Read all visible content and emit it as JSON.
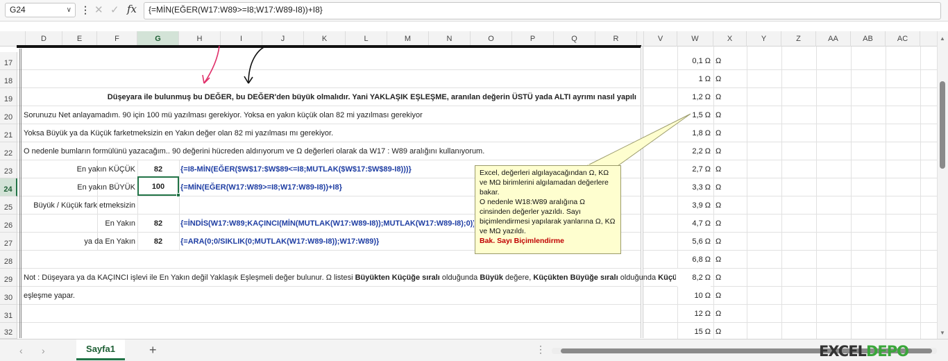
{
  "formula_bar": {
    "name_box": "G24",
    "formula": "{=MİN(EĞER(W17:W89>=I8;W17:W89-I8))+I8}"
  },
  "columns": [
    "D",
    "E",
    "F",
    "G",
    "H",
    "I",
    "J",
    "K",
    "L",
    "M",
    "N",
    "O",
    "P",
    "Q",
    "R",
    "V",
    "W",
    "X",
    "Y",
    "Z",
    "AA",
    "AB",
    "AC"
  ],
  "rows": [
    "17",
    "18",
    "19",
    "20",
    "21",
    "22",
    "23",
    "24",
    "25",
    "26",
    "27",
    "28",
    "29",
    "30",
    "31",
    "32"
  ],
  "selected_cell": "G24",
  "cells": {
    "title19": "Düşeyara ile bulunmuş bu DEĞER, bu DEĞER'den büyük olmalıdır. Yani YAKLAŞIK EŞLEŞME, aranılan değerin ÜSTÜ yada ALTI ayrımı nasıl yapılı",
    "text20": "Sorunuzu Net anlayamadım.  90 için 100 mü yazılması gerekiyor. Yoksa en yakın küçük olan 82 mi yazılması gerekiyor",
    "text21": "Yoksa Büyük ya da Küçük farketmeksizin en Yakın değer olan 82 mi yazılması mı gerekiyor.",
    "text22": "O nedenle  bumların formülünü yazacağım.. 90 değerini hücreden aldırıyorum ve Ω değerleri olarak da W17 : W89 aralığını kullanıyorum.",
    "label23": "En yakın KÜÇÜK",
    "value23": "82",
    "formula23": "{=I8-MİN(EĞER($W$17:$W$89<=I8;MUTLAK($W$17:$W$89-I8)))}",
    "label24": "En yakın BÜYÜK",
    "value24": "100",
    "formula24": "{=MİN(EĞER(W17:W89>=I8;W17:W89-I8))+I8}",
    "label25": "Büyük / Küçük fark etmeksizin",
    "label26": "En Yakın",
    "value26": "82",
    "formula26": "{=İNDİS(W17:W89;KAÇINCI(MİN(MUTLAK(W17:W89-I8));MUTLAK(W17:W89-I8);0))}",
    "label27": "ya da En Yakın",
    "value27": "82",
    "formula27": "{=ARA(0;0/SIKLIK(0;MUTLAK(W17:W89-I8));W17:W89)}",
    "note29_a": "Not : Düşeyara ya da KAÇINCI işlevi ile En Yakın değil Yaklaşık Eşleşmeli değer bulunur. Ω listesi ",
    "note29_b": "Büyükten Küçüğe sıralı",
    "note29_c": " olduğunda ",
    "note29_d": "Büyük",
    "note29_e": " değere, ",
    "note29_f": "Küçükten Büyüğe sıralı",
    "note29_g": " olduğunda ",
    "note29_h": "Küçük",
    "text30": "eşleşme yapar."
  },
  "w_values": [
    "0,1 Ω",
    "1 Ω",
    "1,2 Ω",
    "1,5 Ω",
    "1,8 Ω",
    "2,2 Ω",
    "2,7 Ω",
    "3,3 Ω",
    "3,9 Ω",
    "4,7 Ω",
    "5,6 Ω",
    "6,8 Ω",
    "8,2 Ω",
    "10 Ω",
    "12 Ω",
    "15 Ω"
  ],
  "x_values": [
    "Ω",
    "Ω",
    "Ω",
    "Ω",
    "Ω",
    "Ω",
    "Ω",
    "Ω",
    "Ω",
    "Ω",
    "Ω",
    "Ω",
    "Ω",
    "Ω",
    "Ω",
    "Ω"
  ],
  "callout": {
    "line1": "Excel, değerleri algılayacağından Ω, KΩ ve MΩ birimlerini algılamadan değerlere bakar.",
    "line2": "O nedenle W18:W89 aralığına Ω cinsinden değerler yazıldı. Sayı biçimlendirmesi yapılarak yanlarına Ω, KΩ ve MΩ yazıldı.",
    "line3": "Bak. Sayı Biçimlendirme"
  },
  "sheet_tab": "Sayfa1",
  "logo": {
    "part1": "EXCEL",
    "part2": "DEPO"
  },
  "colors": {
    "accent": "#217346",
    "formula_blue": "#1f3ea3",
    "callout_bg": "#fefecf",
    "callout_red": "#c00000"
  }
}
